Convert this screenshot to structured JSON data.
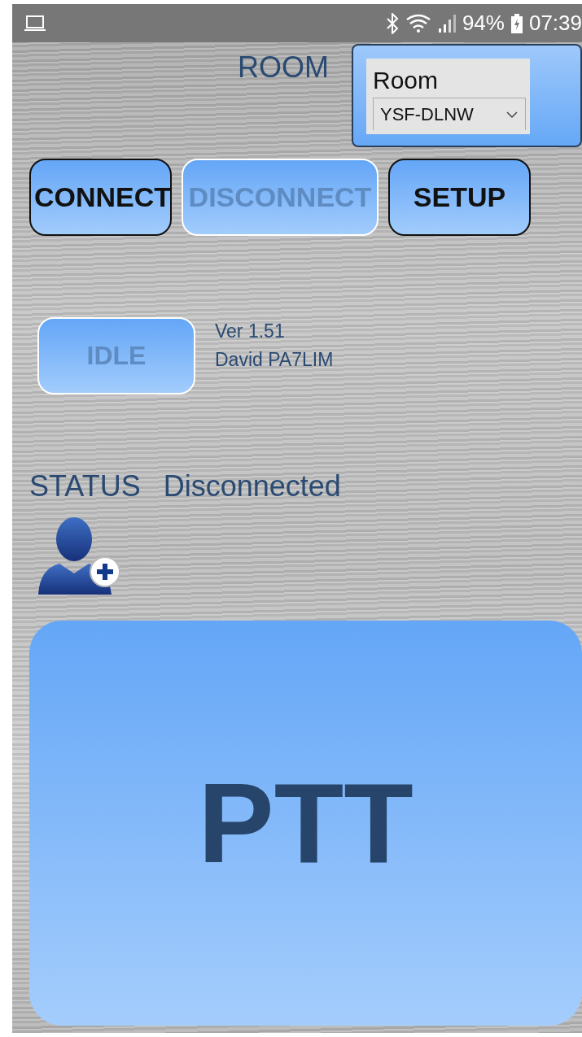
{
  "status_bar": {
    "battery": "94%",
    "time": "07:39"
  },
  "room": {
    "label": "ROOM",
    "panel_title": "Room",
    "select_value": "YSF-DLNW"
  },
  "buttons": [
    {
      "label": "CONNECT",
      "disabled": false
    },
    {
      "label": "DISCONNECT",
      "disabled": true
    },
    {
      "label": "SETUP",
      "disabled": false
    }
  ],
  "mode_button": {
    "label": "IDLE",
    "disabled": true
  },
  "version": "Ver 1.51",
  "author": "David PA7LIM",
  "status": {
    "label": "STATUS",
    "value": "Disconnected"
  },
  "ptt": {
    "label": "PTT"
  }
}
